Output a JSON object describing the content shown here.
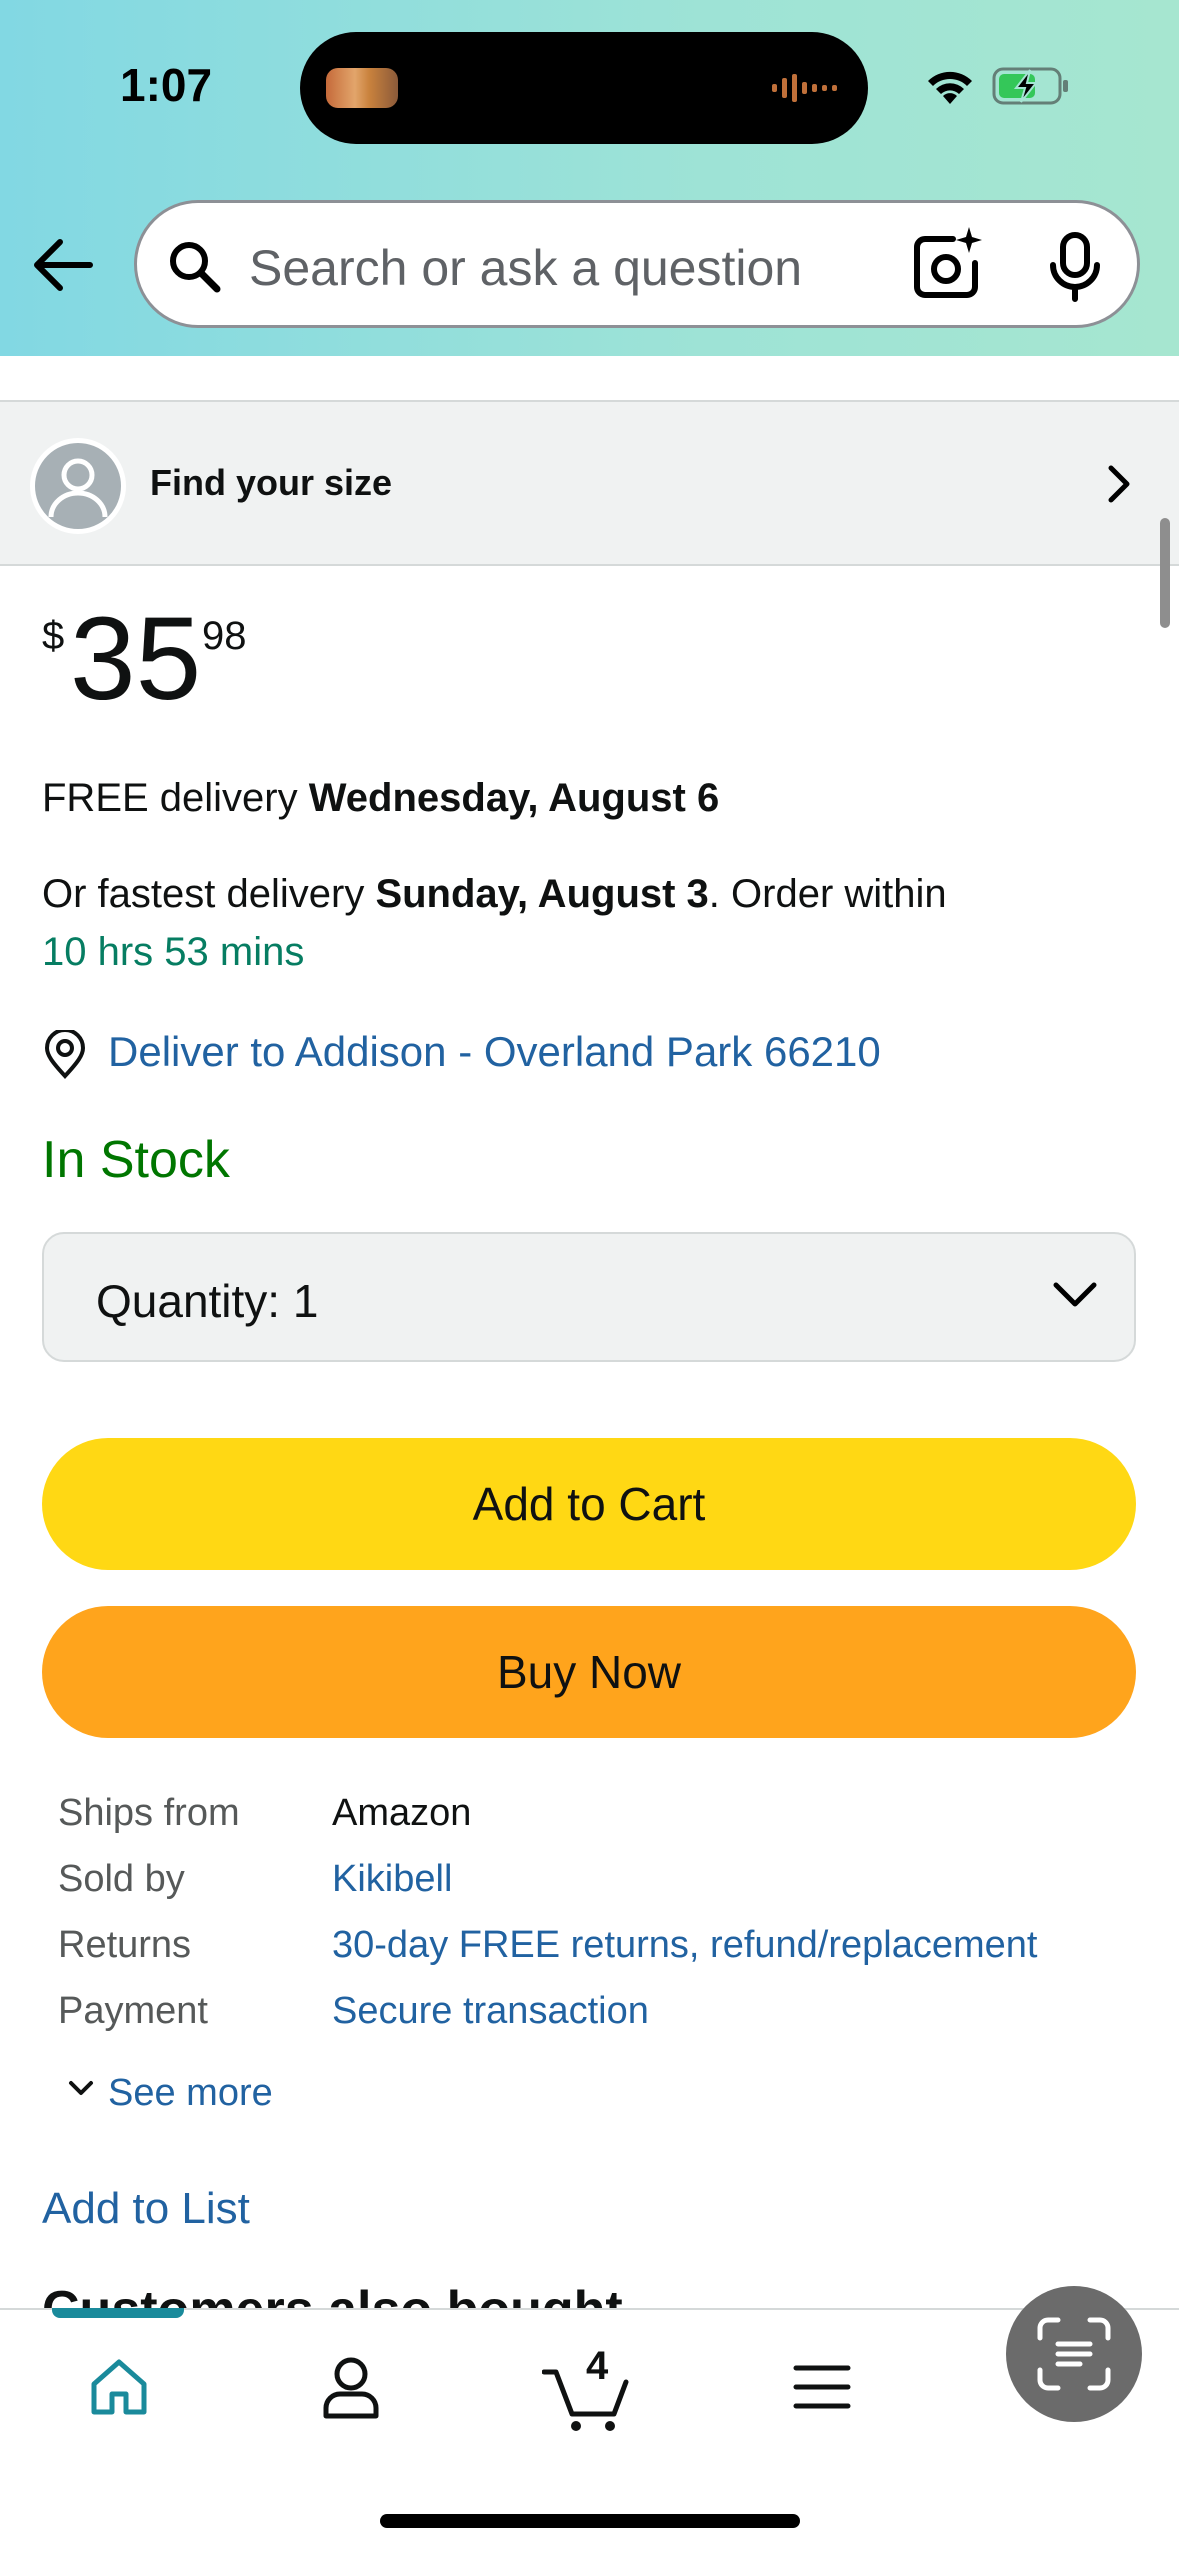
{
  "status_bar": {
    "time": "1:07"
  },
  "search": {
    "placeholder": "Search or ask a question"
  },
  "size_finder": {
    "label": "Find your size"
  },
  "price": {
    "symbol": "$",
    "whole": "35",
    "fraction": "98"
  },
  "delivery": {
    "free_prefix": "FREE delivery ",
    "free_date": "Wednesday, August 6",
    "fast_prefix": "Or fastest delivery ",
    "fast_date": "Sunday, August 3",
    "fast_suffix": ". Order within",
    "countdown": "10 hrs 53 mins",
    "deliver_to": "Deliver to Addison - Overland Park 66210"
  },
  "stock": {
    "status": "In Stock"
  },
  "quantity": {
    "label": "Quantity:",
    "value": "1"
  },
  "buttons": {
    "add_to_cart": "Add to Cart",
    "buy_now": "Buy Now"
  },
  "info": [
    {
      "key": "Ships from",
      "value": "Amazon"
    },
    {
      "key": "Sold by",
      "value": "Kikibell"
    },
    {
      "key": "Returns",
      "value": "30-day FREE returns, refund/replacement"
    },
    {
      "key": "Payment",
      "value": "Secure transaction"
    }
  ],
  "see_more": "See more",
  "add_to_list": "Add to List",
  "section": {
    "title": "Customers also bought"
  },
  "nav": {
    "cart_count": "4"
  },
  "colors": {
    "accent_teal": "#1a8a9b",
    "cart_yellow": "#ffd814",
    "buy_orange": "#ffa41c",
    "link_blue": "#2162a1",
    "stock_green": "#007600"
  },
  "icons": [
    "back-arrow-icon",
    "search-icon",
    "camera-icon",
    "microphone-icon",
    "user-avatar-icon",
    "chevron-right-icon",
    "location-pin-icon",
    "chevron-down-icon",
    "home-icon",
    "account-icon",
    "cart-icon",
    "menu-icon",
    "lens-scan-icon",
    "wifi-icon",
    "battery-icon"
  ]
}
